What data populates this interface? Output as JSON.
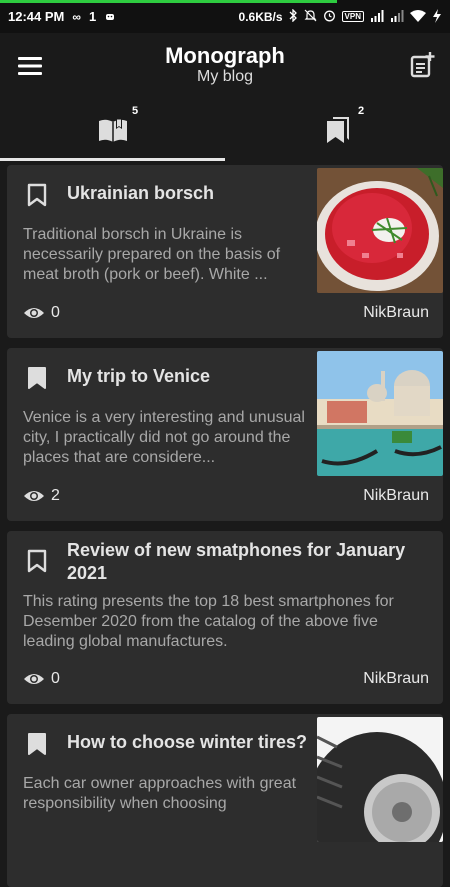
{
  "status_bar": {
    "time": "12:44 PM",
    "extra": "1",
    "net_speed": "0.6KB/s",
    "vpn": "VPN"
  },
  "app_bar": {
    "title": "Monograph",
    "subtitle": "My blog"
  },
  "tabs": [
    {
      "icon": "book-open-icon",
      "badge": "5"
    },
    {
      "icon": "bookmarks-icon",
      "badge": "2"
    }
  ],
  "posts": [
    {
      "title": "Ukrainian borsch",
      "excerpt": "Traditional borsch in Ukraine is necessarily prepared on the basis of meat broth (pork or beef). White ...",
      "views": "0",
      "author": "NikBraun",
      "bookmarked": false
    },
    {
      "title": "My trip to Venice",
      "excerpt": "Venice is a very interesting and unusual city, I practically did not go around the places that are considere...",
      "views": "2",
      "author": "NikBraun",
      "bookmarked": true
    },
    {
      "title": "Review of new smatphones for January 2021",
      "excerpt": "This rating presents the top 18 best smartphones for Desember 2020 from the catalog of the above five leading global manufactures.",
      "views": "0",
      "author": "NikBraun",
      "bookmarked": false
    },
    {
      "title": "How to choose winter tires?",
      "excerpt": "Each car owner approaches with great responsibility when choosing",
      "views": "",
      "author": "",
      "bookmarked": true
    }
  ],
  "colors": {
    "background": "#1a1a1a",
    "card": "#2d2d2d",
    "accent_progress": "#2ecc40"
  }
}
